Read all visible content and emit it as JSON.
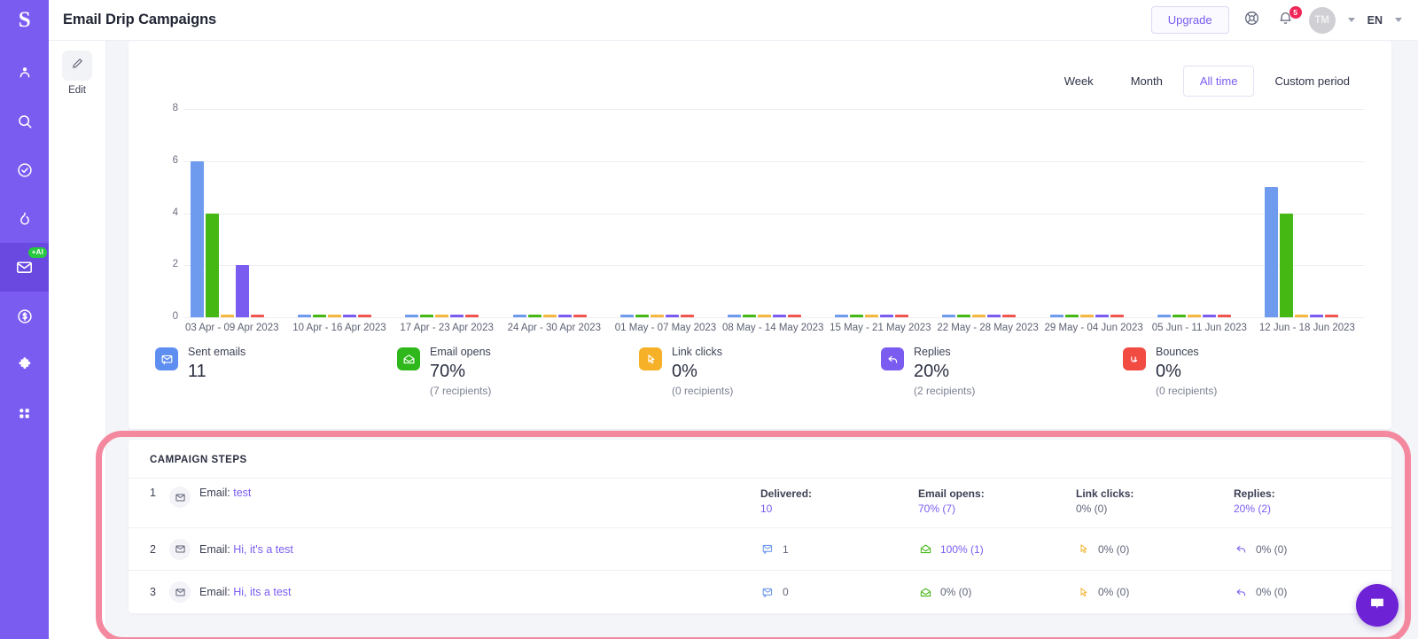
{
  "app": {
    "logo_letter": "S",
    "title": "Email Drip Campaigns"
  },
  "rail": {
    "items": [
      {
        "name": "contacts",
        "icon": "person-icon"
      },
      {
        "name": "search",
        "icon": "search-icon"
      },
      {
        "name": "tasks",
        "icon": "check-circle-icon"
      },
      {
        "name": "activity",
        "icon": "flame-icon"
      },
      {
        "name": "email-campaigns",
        "icon": "envelope-icon",
        "badge": "+AI",
        "active": true
      },
      {
        "name": "deals",
        "icon": "dollar-circle-icon"
      },
      {
        "name": "integrations",
        "icon": "puzzle-icon"
      },
      {
        "name": "apps",
        "icon": "grid-icon"
      }
    ]
  },
  "topbar": {
    "upgrade_label": "Upgrade",
    "help_icon": "lifebuoy-icon",
    "bell_icon": "bell-icon",
    "bell_count": "5",
    "avatar_initials": "TM",
    "language": "EN"
  },
  "edit_panel": {
    "edit_label": "Edit",
    "edit_icon": "pencil-icon"
  },
  "period_tabs": [
    {
      "label": "Week",
      "active": false
    },
    {
      "label": "Month",
      "active": false
    },
    {
      "label": "All time",
      "active": true
    },
    {
      "label": "Custom period",
      "active": false
    }
  ],
  "chart_data": {
    "type": "bar",
    "title": "",
    "xlabel": "",
    "ylabel": "",
    "ylim": [
      0,
      8
    ],
    "yticks": [
      8,
      6,
      4,
      2,
      0
    ],
    "grid": true,
    "legend": "none",
    "categories": [
      "03 Apr - 09 Apr 2023",
      "10 Apr - 16 Apr 2023",
      "17 Apr - 23 Apr 2023",
      "24 Apr - 30 Apr 2023",
      "01 May - 07 May 2023",
      "08 May - 14 May 2023",
      "15 May - 21 May 2023",
      "22 May - 28 May 2023",
      "29 May - 04 Jun 2023",
      "05 Jun - 11 Jun 2023",
      "12 Jun - 18 Jun 2023"
    ],
    "series": [
      {
        "name": "Sent emails",
        "color": "#6f9bef",
        "values": [
          6,
          0,
          0,
          0,
          0,
          0,
          0,
          0,
          0,
          0,
          5
        ]
      },
      {
        "name": "Email opens",
        "color": "#46b814",
        "values": [
          4,
          0,
          0,
          0,
          0,
          0,
          0,
          0,
          0,
          0,
          4
        ]
      },
      {
        "name": "Link clicks",
        "color": "#f5b73d",
        "values": [
          0,
          0,
          0,
          0,
          0,
          0,
          0,
          0,
          0,
          0,
          0
        ]
      },
      {
        "name": "Replies",
        "color": "#7b5cf0",
        "values": [
          2,
          0,
          0,
          0,
          0,
          0,
          0,
          0,
          0,
          0,
          0
        ]
      },
      {
        "name": "Bounces",
        "color": "#f2554e",
        "values": [
          0,
          0,
          0,
          0,
          0,
          0,
          0,
          0,
          0,
          0,
          0
        ]
      }
    ]
  },
  "stats": [
    {
      "icon": "sent-envelope-icon",
      "color": "#5e8ef0",
      "label": "Sent emails",
      "value": "11",
      "sub": ""
    },
    {
      "icon": "open-envelope-icon",
      "color": "#2fb81b",
      "label": "Email opens",
      "value": "70%",
      "sub": "(7 recipients)"
    },
    {
      "icon": "click-cursor-icon",
      "color": "#f7b128",
      "label": "Link clicks",
      "value": "0%",
      "sub": "(0 recipients)"
    },
    {
      "icon": "reply-arrow-icon",
      "color": "#7b5cf0",
      "label": "Replies",
      "value": "20%",
      "sub": "(2 recipients)"
    },
    {
      "icon": "bounce-arrow-icon",
      "color": "#f24b42",
      "label": "Bounces",
      "value": "0%",
      "sub": "(0 recipients)"
    }
  ],
  "campaign_steps": {
    "heading": "CAMPAIGN STEPS",
    "column_headers": [
      "Delivered:",
      "Email opens:",
      "Link clicks:",
      "Replies:"
    ],
    "rows": [
      {
        "num": "1",
        "prefix": "Email:",
        "subject": "test",
        "delivered": "10",
        "email_opens": "70% (7)",
        "link_clicks": "0% (0)",
        "replies": "20% (2)",
        "show_headers": true
      },
      {
        "num": "2",
        "prefix": "Email:",
        "subject": "Hi, it's a test",
        "delivered": "1",
        "email_opens": "100% (1)",
        "link_clicks": "0% (0)",
        "replies": "0% (0)",
        "show_headers": false
      },
      {
        "num": "3",
        "prefix": "Email:",
        "subject": "Hi, its a test",
        "delivered": "0",
        "email_opens": "0% (0)",
        "link_clicks": "0% (0)",
        "replies": "0% (0)",
        "show_headers": false
      }
    ]
  },
  "chat": {
    "icon": "chat-bubble-icon"
  },
  "colors": {
    "brand_purple": "#7b5cf0",
    "rail_purple": "#7b5cf0",
    "highlight_pink": "#f4889f",
    "badge_red": "#f0285a",
    "ai_green": "#27c93f"
  }
}
